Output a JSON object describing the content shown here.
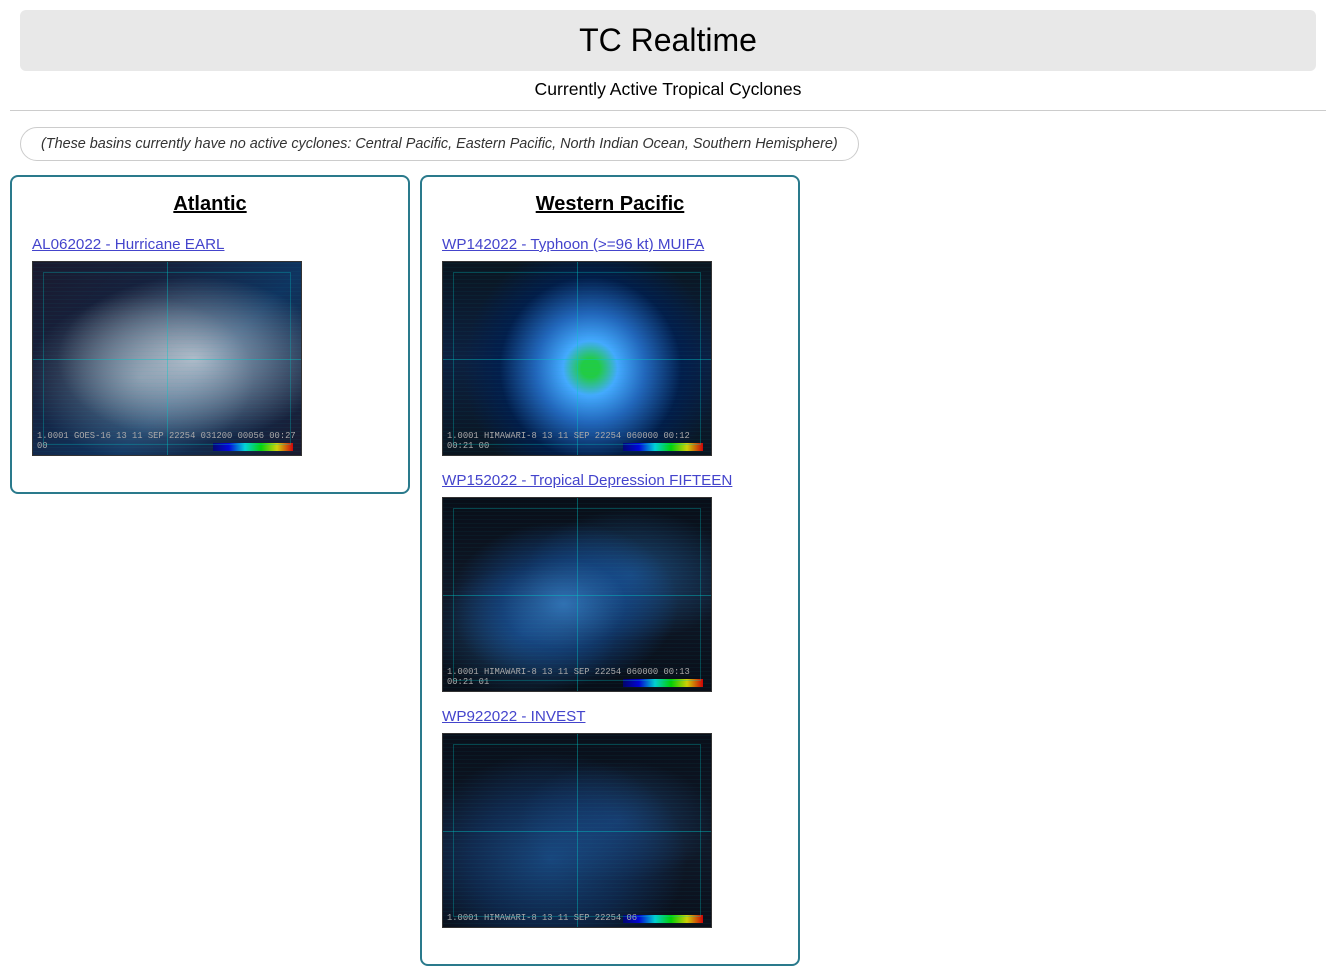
{
  "header": {
    "title": "TC Realtime",
    "subtitle": "Currently Active Tropical Cyclones"
  },
  "no_activity_notice": "(These basins currently have no active cyclones: Central Pacific, Eastern Pacific, North Indian Ocean, Southern Hemisphere)",
  "basins": {
    "atlantic": {
      "heading": "Atlantic",
      "storms": [
        {
          "id": "AL062022",
          "label": "AL062022 - Hurricane EARL",
          "img_class": "img-hurricane-earl",
          "img_label": "1.0001 GOES-16  13 11 SEP 22254 031200 00056 00:27 00",
          "link": "#"
        }
      ]
    },
    "western_pacific": {
      "heading": "Western Pacific",
      "storms": [
        {
          "id": "WP142022",
          "label": "WP142022 - Typhoon (>=96 kt) MUIFA",
          "img_class": "img-typhoon-muifa",
          "img_label": "1.0001 HIMAWARI-8  13 11 SEP 22254 060000 00:12 00:21 00",
          "link": "#"
        },
        {
          "id": "WP152022",
          "label": "WP152022 - Tropical Depression FIFTEEN",
          "img_class": "img-td-fifteen",
          "img_label": "1.0001 HIMAWARI-8  13 11 SEP 22254 060000 00:13 00:21 01",
          "link": "#"
        },
        {
          "id": "WP922022",
          "label": "WP922022 - INVEST",
          "img_class": "img-invest-wp922",
          "img_label": "1.0001 HIMAWARI-8  13 11 SEP 22254 06",
          "link": "#"
        }
      ]
    }
  }
}
